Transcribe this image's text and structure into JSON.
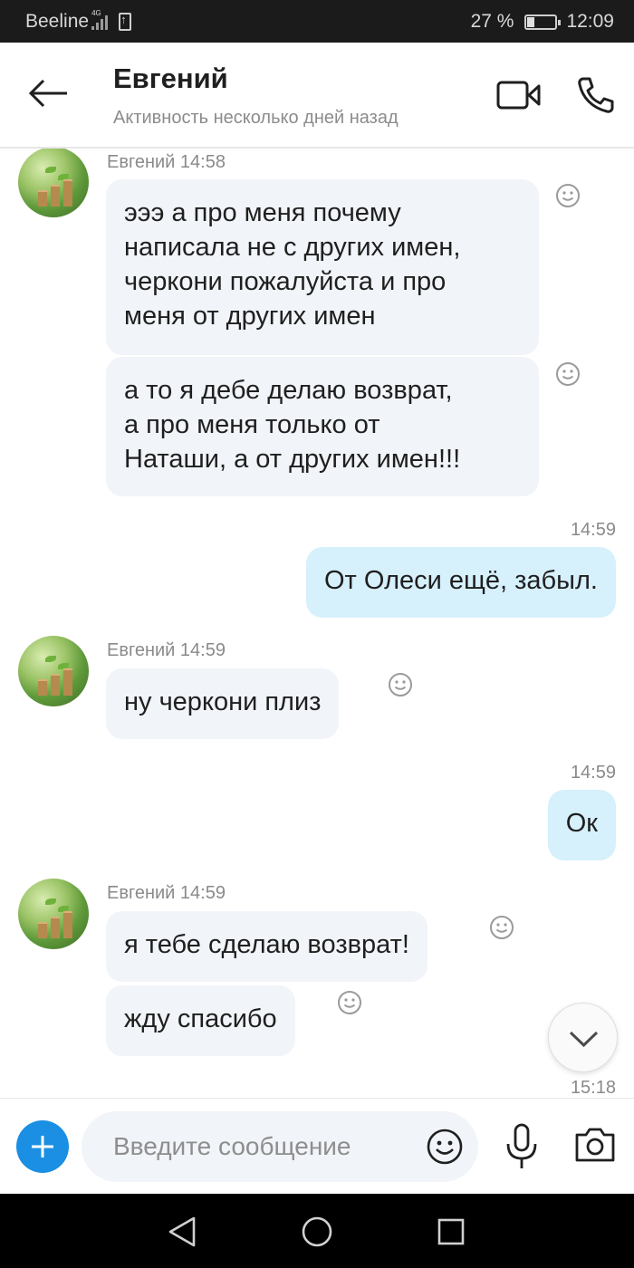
{
  "status_bar": {
    "carrier": "Beeline",
    "network": "4G",
    "battery_percent": "27 %",
    "time": "12:09"
  },
  "header": {
    "contact_name": "Евгений",
    "contact_status": "Активность несколько дней назад",
    "icons": [
      "back-arrow-icon",
      "video-call-icon",
      "phone-call-icon"
    ]
  },
  "messages": [
    {
      "direction": "in",
      "sender_line": "Евгений 14:58",
      "bubbles": [
        "эээ а про меня почему\nнаписала не с других имен,\nчеркони пожалуйста и про\nменя от других имен",
        "а то я дебе делаю возврат,\nа про меня только от\nНаташи, а от других имен!!!"
      ]
    },
    {
      "direction": "out",
      "time": "14:59",
      "bubbles": [
        "От Олеси ещё, забыл."
      ]
    },
    {
      "direction": "in",
      "sender_line": "Евгений 14:59",
      "bubbles": [
        "ну черкони плиз"
      ]
    },
    {
      "direction": "out",
      "time": "14:59",
      "bubbles": [
        "Ок"
      ]
    },
    {
      "direction": "in",
      "sender_line": "Евгений 14:59",
      "bubbles": [
        "я тебе сделаю возврат!",
        "жду спасибо"
      ]
    }
  ],
  "partial_time": "15:18",
  "composer": {
    "placeholder": "Введите сообщение",
    "value": "",
    "icons": [
      "plus-icon",
      "emoji-icon",
      "microphone-icon",
      "camera-icon"
    ]
  },
  "colors": {
    "accent": "#1a8fe3",
    "bubble_in": "#f1f4f8",
    "bubble_out": "#d6f0fc",
    "status_bar": "#1b1b1b",
    "nav_bar": "#000000"
  }
}
